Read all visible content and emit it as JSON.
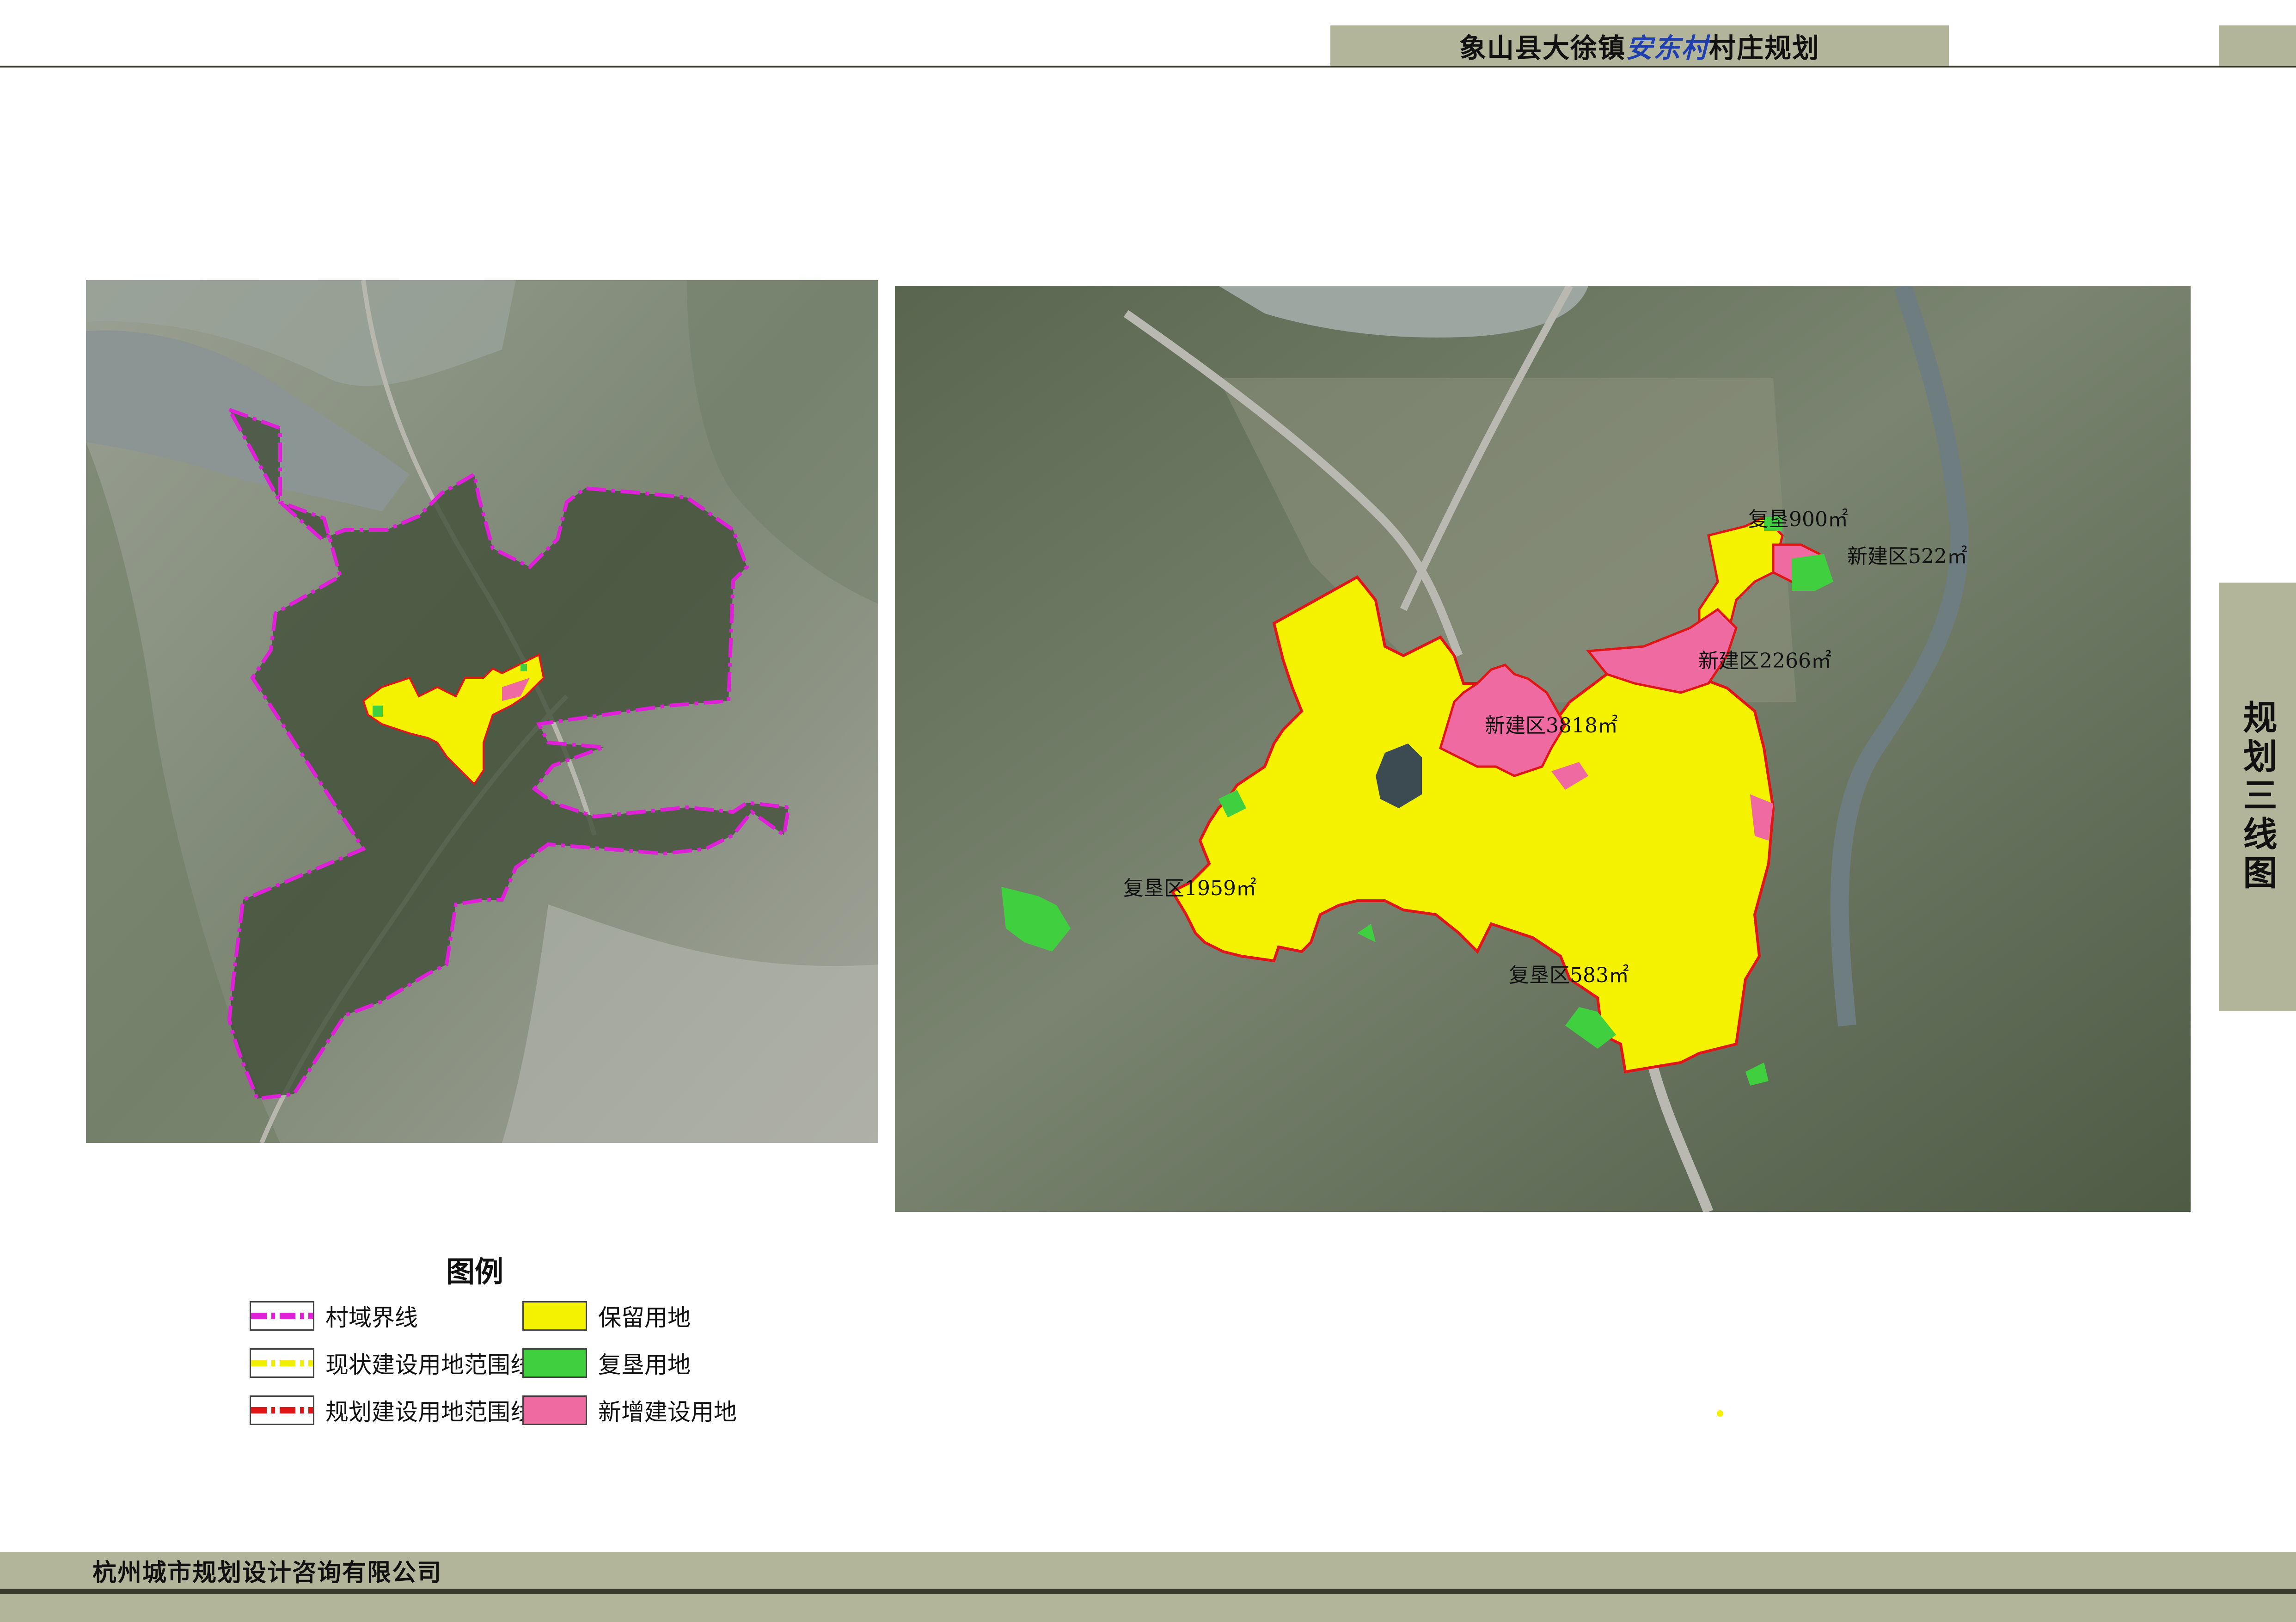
{
  "header": {
    "title_prefix": "象山县大徐镇",
    "title_highlight": "安东村",
    "title_suffix": "村庄规划",
    "accent_color": "#1f3fb0",
    "band_color": "#b3b59a"
  },
  "side_tab": {
    "label": "规划三线图"
  },
  "map_right": {
    "annotations": [
      {
        "id": "a1",
        "text": "复垦900㎡"
      },
      {
        "id": "a2",
        "text": "新建区522㎡"
      },
      {
        "id": "a3",
        "text": "新建区2266㎡"
      },
      {
        "id": "a4",
        "text": "新建区3818㎡"
      },
      {
        "id": "a5",
        "text": "复垦区1959㎡"
      },
      {
        "id": "a6",
        "text": "复垦区583㎡"
      }
    ]
  },
  "legend": {
    "title": "图例",
    "items": [
      {
        "label": "村域界线",
        "kind": "dash",
        "color": "#e020d8"
      },
      {
        "label": "现状建设用地范围线",
        "kind": "dash",
        "color": "#f2ee00"
      },
      {
        "label": "规划建设用地范围线",
        "kind": "dash",
        "color": "#e01515"
      },
      {
        "label": "保留用地",
        "kind": "fill",
        "color": "#f5f200"
      },
      {
        "label": "复垦用地",
        "kind": "fill",
        "color": "#3fcf3f"
      },
      {
        "label": "新增建设用地",
        "kind": "fill",
        "color": "#ee6aa0"
      }
    ]
  },
  "footer": {
    "company": "杭州城市规划设计咨询有限公司"
  },
  "colors": {
    "boundary": "#e020d8",
    "reserved": "#f5f200",
    "reclaim": "#3fcf3f",
    "new_build": "#ee6aa0",
    "plan_line": "#e01515",
    "terrain_dark": "#4a5a42",
    "terrain_mid": "#7c8773",
    "water": "#8f9a98"
  }
}
